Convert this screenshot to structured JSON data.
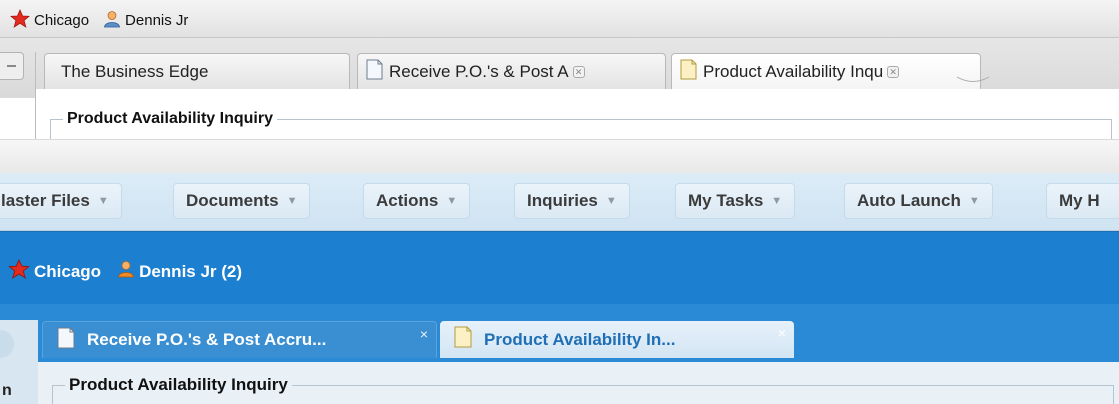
{
  "old": {
    "location": {
      "branch": "Chicago",
      "user": "Dennis Jr"
    },
    "tabs": [
      {
        "label": "The Business Edge"
      },
      {
        "label": "Receive P.O.'s & Post A"
      },
      {
        "label": "Product Availability Inqu"
      }
    ],
    "close_glyph": "✕",
    "panel_title": "Product Availability Inquiry"
  },
  "new": {
    "menus": [
      {
        "label": "laster Files"
      },
      {
        "label": "Documents"
      },
      {
        "label": "Actions"
      },
      {
        "label": "Inquiries"
      },
      {
        "label": "My Tasks"
      },
      {
        "label": "Auto Launch"
      },
      {
        "label": "My H"
      }
    ],
    "caret": "▼",
    "location": {
      "branch": "Chicago",
      "user": "Dennis Jr (2)"
    },
    "tabs": [
      {
        "label": "Receive P.O.'s & Post Accru..."
      },
      {
        "label": "Product Availability In..."
      }
    ],
    "close_glyph": "×",
    "side_letter": "n",
    "panel_title": "Product Availability Inquiry"
  },
  "colors": {
    "new_accent_blue": "#1c7fd0",
    "new_menu_bg": "#d5e7f4",
    "star_red": "#e32a1f",
    "user_orange": "#f08a24"
  },
  "icons": {
    "branch": "star-icon",
    "user": "user-icon",
    "document": "document-icon",
    "collapse": "collapse-icon"
  }
}
